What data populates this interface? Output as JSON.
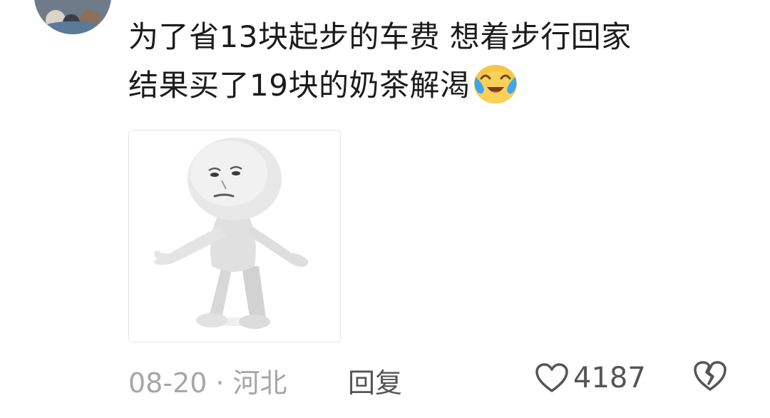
{
  "comment": {
    "text_lines": [
      "为了省13块起步的车费 想着步行回家",
      "结果买了19块的奶茶解渴"
    ],
    "emoji": "crying-laughing-emoji",
    "image": {
      "icon": "shrugging-white-figure-meme"
    },
    "footer": {
      "date": "08-20",
      "separator": "·",
      "location": "河北",
      "reply_label": "回复",
      "like_count": "4187",
      "like_icon": "heart-outline-icon",
      "dislike_icon": "broken-heart-icon"
    }
  },
  "colors": {
    "text": "#1b1b1b",
    "meta": "#a6a6a6",
    "action": "#555555",
    "emoji": "#f7c744"
  }
}
